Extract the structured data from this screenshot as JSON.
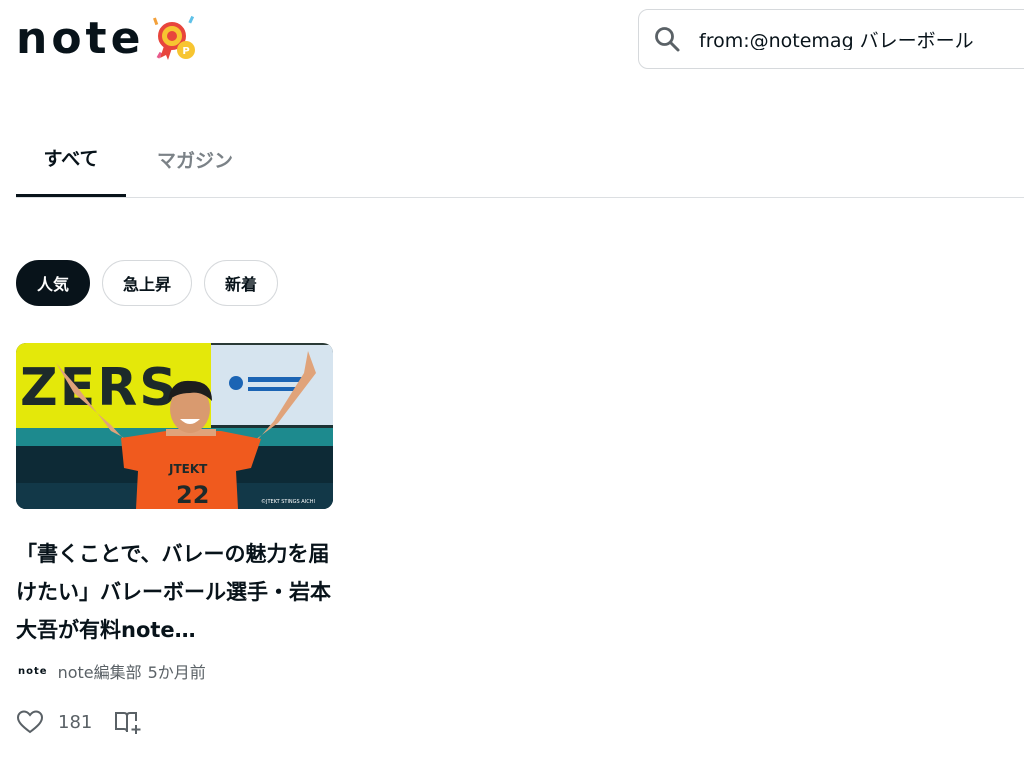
{
  "header": {
    "logo": "note",
    "logo_decoration": "event-medal-icon",
    "search": {
      "icon": "search-icon",
      "value": "from:@notemag バレーボール"
    }
  },
  "tabs": [
    {
      "label": "すべて",
      "active": true
    },
    {
      "label": "マガジン",
      "active": false
    }
  ],
  "filters": [
    {
      "label": "人気",
      "active": true
    },
    {
      "label": "急上昇",
      "active": false
    },
    {
      "label": "新着",
      "active": false
    }
  ],
  "results": [
    {
      "thumbnail_caption": "©JTEKT STINGS AICHI",
      "title": "「書くことで、バレーの魅力を届けたい」バレーボール選手・岩本大吾が有料note…",
      "author_logo": "note",
      "author": "note編集部",
      "time": "5か月前",
      "likes": "181",
      "like_icon": "heart-icon",
      "magazine_icon": "add-to-magazine-icon"
    }
  ],
  "colors": {
    "text": "#08131a",
    "muted": "#7b8287",
    "jersey": "#f05a1e",
    "banner_yellow": "#e4e80a"
  }
}
